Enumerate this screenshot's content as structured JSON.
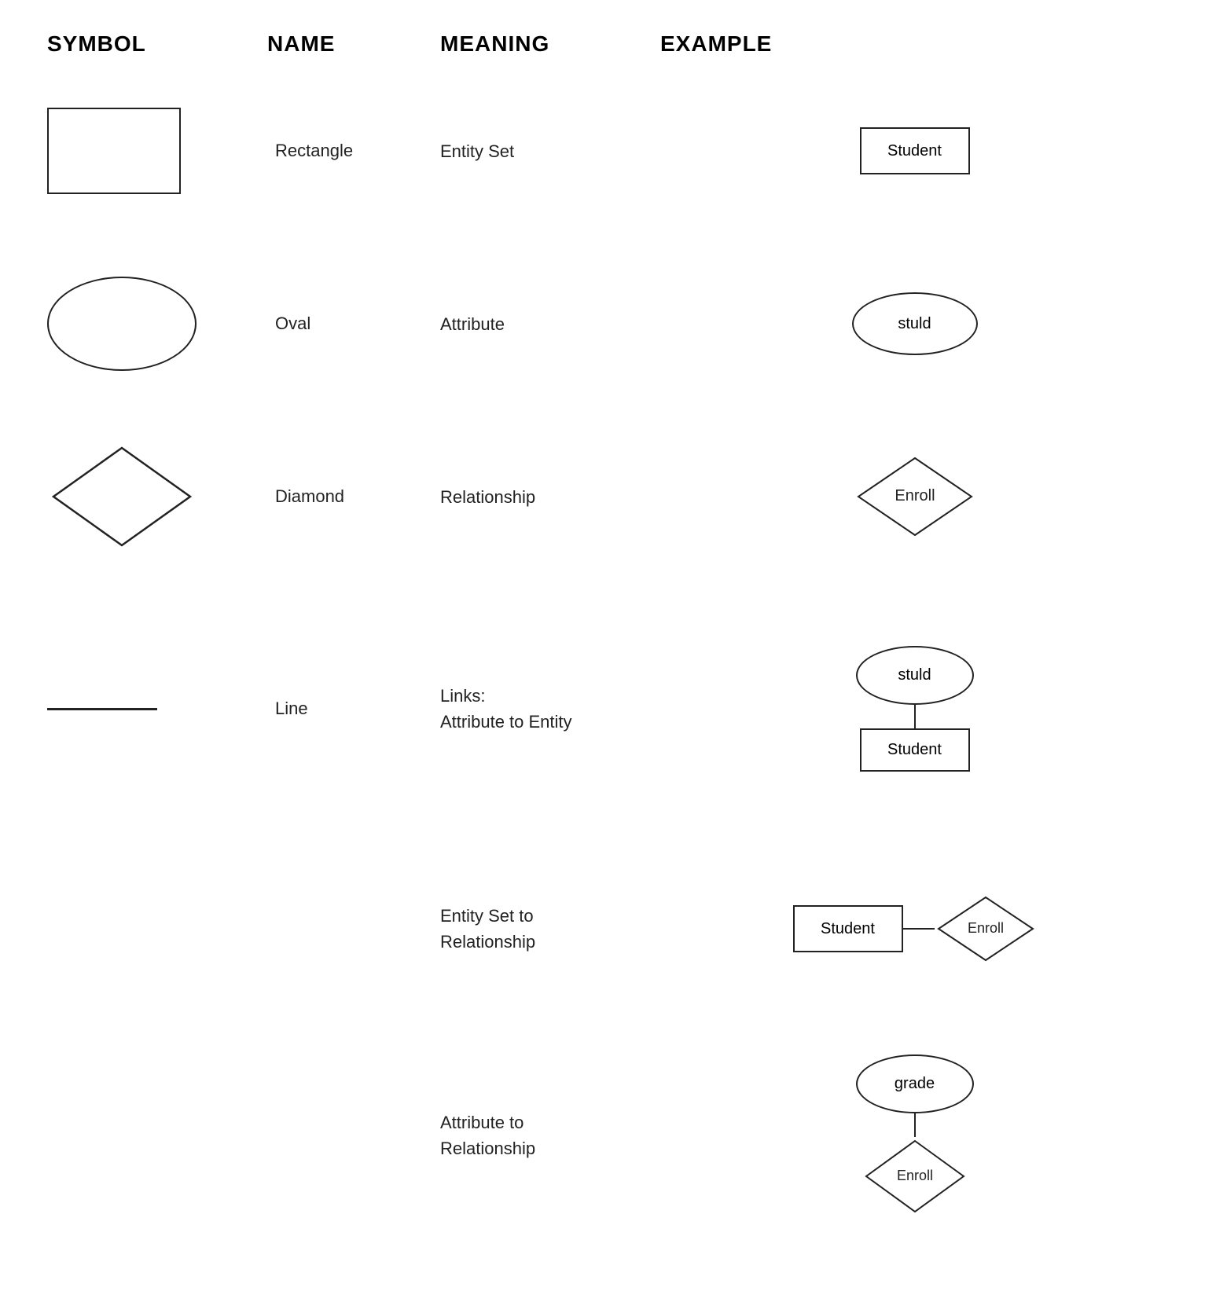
{
  "header": {
    "col1": "SYMBOL",
    "col2": "NAME",
    "col3": "MEANING",
    "col4": "EXAMPLE"
  },
  "rows": [
    {
      "id": "rectangle",
      "name": "Rectangle",
      "meaning": "Entity Set",
      "example_label": "Student",
      "shape_type": "rectangle"
    },
    {
      "id": "oval",
      "name": "Oval",
      "meaning": "Attribute",
      "example_label": "stuld",
      "shape_type": "oval"
    },
    {
      "id": "diamond",
      "name": "Diamond",
      "meaning": "Relationship",
      "example_label": "Enroll",
      "shape_type": "diamond"
    },
    {
      "id": "line",
      "name": "Line",
      "meaning_line1": "Links:",
      "meaning_line2": "Attribute to Entity",
      "example_oval_label": "stuld",
      "example_rect_label": "Student",
      "shape_type": "line"
    }
  ],
  "bottom_rows": [
    {
      "id": "entity-rel",
      "meaning_line1": "Entity Set to",
      "meaning_line2": "Relationship",
      "rect_label": "Student",
      "diamond_label": "Enroll"
    },
    {
      "id": "attr-rel",
      "meaning_line1": "Attribute to",
      "meaning_line2": "Relationship",
      "oval_label": "grade",
      "diamond_label": "Enroll"
    }
  ]
}
